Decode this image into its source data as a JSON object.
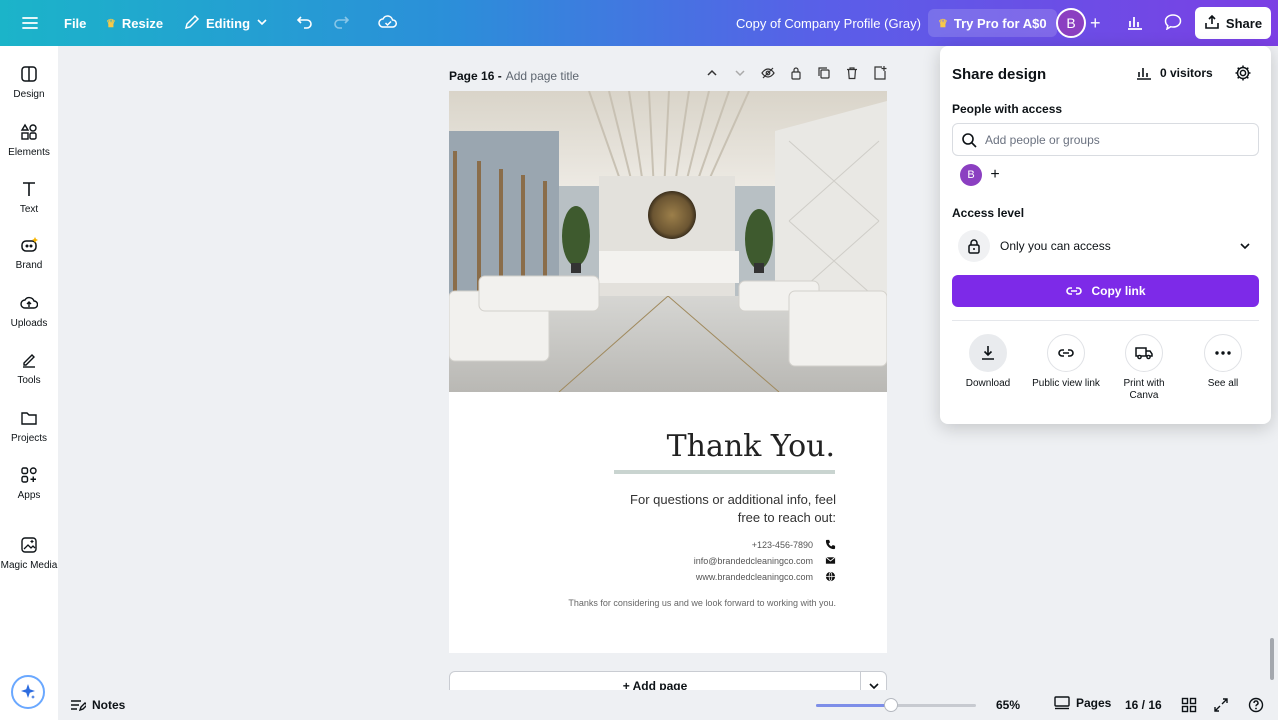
{
  "topbar": {
    "file": "File",
    "resize": "Resize",
    "editing": "Editing",
    "doc_title": "Copy of Company Profile (Gray)",
    "try_pro": "Try Pro for A$0",
    "avatar_initial": "B",
    "share": "Share"
  },
  "sidebar": {
    "items": [
      {
        "label": "Design",
        "icon": "design-icon"
      },
      {
        "label": "Elements",
        "icon": "elements-icon"
      },
      {
        "label": "Text",
        "icon": "text-icon"
      },
      {
        "label": "Brand",
        "icon": "brand-icon"
      },
      {
        "label": "Uploads",
        "icon": "uploads-icon"
      },
      {
        "label": "Tools",
        "icon": "tools-icon"
      },
      {
        "label": "Projects",
        "icon": "projects-icon"
      },
      {
        "label": "Apps",
        "icon": "apps-icon"
      },
      {
        "label": "Magic Media",
        "icon": "magic-media-icon"
      }
    ]
  },
  "page": {
    "number": "Page 16 -",
    "title_placeholder": "Add page title",
    "thank_you": "Thank You.",
    "question_line1": "For questions or additional info, feel",
    "question_line2": "free to reach out:",
    "phone": "+123-456-7890",
    "email": "info@brandedcleaningco.com",
    "website": "www.brandedcleaningco.com",
    "closing": "Thanks for considering us and we look forward to working with you."
  },
  "add_page": "+ Add page",
  "bottom": {
    "notes": "Notes",
    "zoom": "65%",
    "zoom_level": 0.65,
    "pages": "Pages",
    "page_count": "16 / 16"
  },
  "share_panel": {
    "title": "Share design",
    "visitors": "0 visitors",
    "people_label": "People with access",
    "search_placeholder": "Add people or groups",
    "avatar_initial": "B",
    "access_label": "Access level",
    "access_value": "Only you can access",
    "copy_link": "Copy link",
    "actions": [
      {
        "label": "Download",
        "icon": "download-icon"
      },
      {
        "label": "Public view link",
        "icon": "link-icon"
      },
      {
        "label": "Print with Canva",
        "icon": "truck-icon"
      },
      {
        "label": "See all",
        "icon": "more-icon"
      }
    ]
  },
  "colors": {
    "accent": "#7d2ae8",
    "avatar": "#8b3fc1"
  }
}
